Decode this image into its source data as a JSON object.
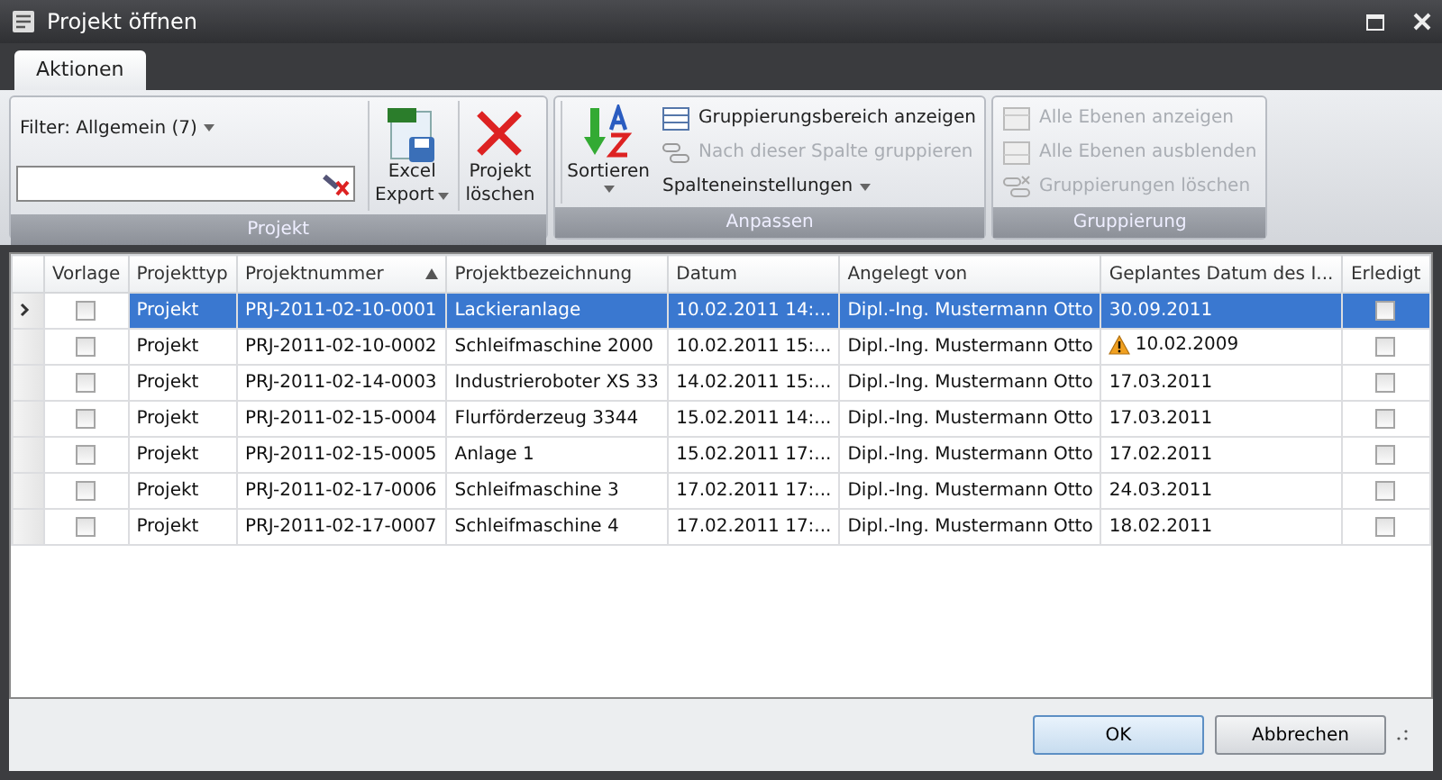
{
  "window": {
    "title": "Projekt öffnen"
  },
  "tabs": [
    {
      "label": "Aktionen",
      "selected": true
    }
  ],
  "ribbon": {
    "groups": [
      {
        "title": "Projekt",
        "filter_label": "Filter: Allgemein (7)",
        "buttons": [
          {
            "kind": "excel",
            "label": "Excel",
            "label2": "Export",
            "dropdown": true,
            "disabled": false
          },
          {
            "kind": "delete",
            "label": "Projekt",
            "label2": "löschen",
            "dropdown": false,
            "disabled": false
          }
        ]
      },
      {
        "title": "Anpassen",
        "buttons": [
          {
            "kind": "sort",
            "label": "Sortieren",
            "dropdown": true,
            "disabled": false
          }
        ],
        "items": [
          {
            "kind": "group-area",
            "label": "Gruppierungsbereich anzeigen",
            "disabled": false,
            "dropdown": false
          },
          {
            "kind": "group-col",
            "label": "Nach dieser Spalte gruppieren",
            "disabled": true,
            "dropdown": false
          },
          {
            "kind": "none",
            "label": "Spalteneinstellungen",
            "disabled": false,
            "dropdown": true
          }
        ]
      },
      {
        "title": "Gruppierung",
        "items": [
          {
            "kind": "expand",
            "label": "Alle Ebenen anzeigen",
            "disabled": true,
            "dropdown": false
          },
          {
            "kind": "collapse",
            "label": "Alle Ebenen ausblenden",
            "disabled": true,
            "dropdown": false
          },
          {
            "kind": "clear",
            "label": "Gruppierungen löschen",
            "disabled": true,
            "dropdown": false
          }
        ]
      }
    ]
  },
  "table": {
    "columns": [
      {
        "label": "Vorlage",
        "sorted": false
      },
      {
        "label": "Projekttyp",
        "sorted": false
      },
      {
        "label": "Projektnummer",
        "sorted": true
      },
      {
        "label": "Projektbezeichnung",
        "sorted": false
      },
      {
        "label": "Datum",
        "sorted": false
      },
      {
        "label": "Angelegt von",
        "sorted": false
      },
      {
        "label": "Geplantes Datum des I...",
        "sorted": false
      },
      {
        "label": "Erledigt",
        "sorted": false
      }
    ],
    "rows": [
      {
        "selected": true,
        "vorlage": false,
        "type": "Projekt",
        "number": "PRJ-2011-02-10-0001",
        "name": "Lackieranlage",
        "date": "10.02.2011 14:...",
        "author": "Dipl.-Ing. Mustermann Otto",
        "planned": "30.09.2011",
        "warning": false,
        "done": false
      },
      {
        "selected": false,
        "vorlage": false,
        "type": "Projekt",
        "number": "PRJ-2011-02-10-0002",
        "name": "Schleifmaschine 2000",
        "date": "10.02.2011 15:...",
        "author": "Dipl.-Ing. Mustermann Otto",
        "planned": "10.02.2009",
        "warning": true,
        "done": false
      },
      {
        "selected": false,
        "vorlage": false,
        "type": "Projekt",
        "number": "PRJ-2011-02-14-0003",
        "name": "Industrieroboter XS 33",
        "date": "14.02.2011 15:...",
        "author": "Dipl.-Ing. Mustermann Otto",
        "planned": "17.03.2011",
        "warning": false,
        "done": false
      },
      {
        "selected": false,
        "vorlage": false,
        "type": "Projekt",
        "number": "PRJ-2011-02-15-0004",
        "name": "Flurförderzeug 3344",
        "date": "15.02.2011 14:...",
        "author": "Dipl.-Ing. Mustermann Otto",
        "planned": "17.03.2011",
        "warning": false,
        "done": false
      },
      {
        "selected": false,
        "vorlage": false,
        "type": "Projekt",
        "number": "PRJ-2011-02-15-0005",
        "name": "Anlage 1",
        "date": "15.02.2011 17:...",
        "author": "Dipl.-Ing. Mustermann Otto",
        "planned": "17.02.2011",
        "warning": false,
        "done": false
      },
      {
        "selected": false,
        "vorlage": false,
        "type": "Projekt",
        "number": "PRJ-2011-02-17-0006",
        "name": "Schleifmaschine 3",
        "date": "17.02.2011 17:...",
        "author": "Dipl.-Ing. Mustermann Otto",
        "planned": "24.03.2011",
        "warning": false,
        "done": false
      },
      {
        "selected": false,
        "vorlage": false,
        "type": "Projekt",
        "number": "PRJ-2011-02-17-0007",
        "name": "Schleifmaschine 4",
        "date": "17.02.2011 17:...",
        "author": "Dipl.-Ing. Mustermann Otto",
        "planned": "18.02.2011",
        "warning": false,
        "done": false
      }
    ]
  },
  "buttons": [
    {
      "label": "OK",
      "kind": "default"
    },
    {
      "label": "Abbrechen",
      "kind": "normal"
    }
  ]
}
